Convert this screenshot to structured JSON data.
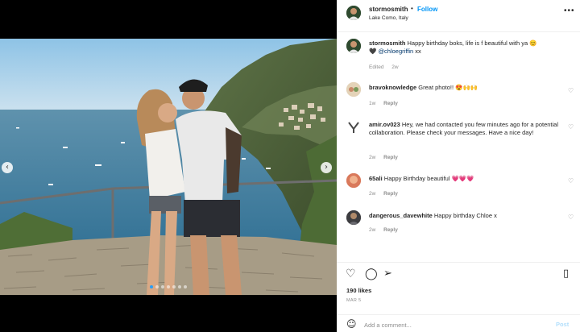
{
  "media": {
    "carousel_total": 7,
    "carousel_active_index": 0
  },
  "header": {
    "username": "stormosmith",
    "separator": "•",
    "follow_label": "Follow",
    "location": "Lake Como, Italy",
    "more_icon": "more-horizontal-icon"
  },
  "caption": {
    "username": "stormosmith",
    "text": "Happy birthday boks, life is f beautiful with ya 😊",
    "line2_symbol": "🖤",
    "mention": "@chloegriffin",
    "suffix": "xx",
    "edited": "Edited",
    "time": "2w"
  },
  "comments": [
    {
      "username": "bravoknowledge",
      "text": "Great photo!! 😍🙌🙌",
      "time": "1w",
      "reply": "Reply"
    },
    {
      "username": "amir.ov023",
      "text": "Hey, we had contacted you few minutes ago for a potential collaboration. Please check your messages. Have a nice day!",
      "time": "2w",
      "reply": "Reply"
    },
    {
      "username": "65ali",
      "text": "Happy Birthday beautiful 💗💗💗",
      "time": "2w",
      "reply": "Reply"
    },
    {
      "username": "dangerous_davewhite",
      "text": "Happy birthday Chloe x",
      "time": "2w",
      "reply": "Reply"
    }
  ],
  "actions": {
    "likes": "190 likes",
    "date": "MAR 5",
    "add_comment_placeholder": "Add a comment...",
    "post_label": "Post"
  },
  "colors": {
    "accent": "#0095f6",
    "text": "#262626",
    "muted": "#8e8e8e"
  }
}
